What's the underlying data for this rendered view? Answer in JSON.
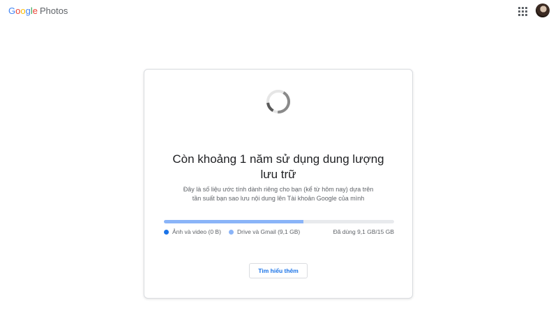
{
  "header": {
    "logo": {
      "letters": [
        "G",
        "o",
        "o",
        "g",
        "l",
        "e"
      ],
      "product": "Photos"
    },
    "apps_icon": "apps-grid-icon",
    "avatar_icon": "account-avatar"
  },
  "card": {
    "spinner_icon": "loading-spinner",
    "headline_line1": "Còn khoảng 1 năm sử dụng dung lượng",
    "headline_line2": "lưu trữ",
    "subtext_line1": "Đây là số liệu ước tính dành riêng cho bạn (kể từ hôm nay) dựa trên",
    "subtext_line2": "tần suất bạn sao lưu nội dung lên Tài khoản Google của mình",
    "storage": {
      "used_gb": 9.1,
      "total_gb": 15,
      "photos_fraction": 0.0,
      "drive_fraction": 0.607,
      "legend_photos": "Ảnh và video (0 B)",
      "legend_drive": "Drive và Gmail (9,1 GB)",
      "used_label": "Đã dùng 9,1 GB/15 GB",
      "colors": {
        "photos": "#1a73e8",
        "drive": "#8ab4f8",
        "track": "#e8eaed"
      }
    },
    "learn_more_label": "Tìm hiểu thêm"
  }
}
